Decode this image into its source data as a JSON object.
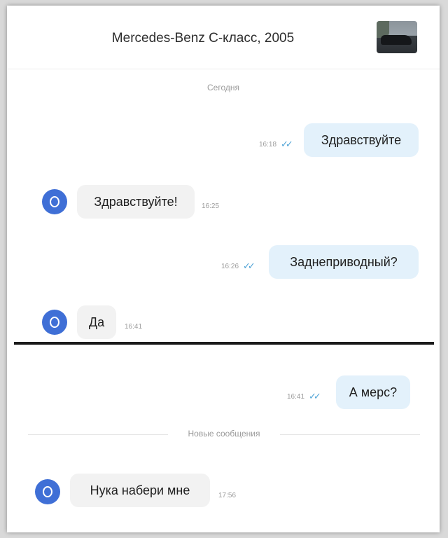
{
  "header": {
    "title": "Mercedes-Benz C-класс, 2005",
    "thumbnail_icon": "car-photo"
  },
  "day_label": "Сегодня",
  "messages": [
    {
      "direction": "out",
      "text": "Здравствуйте",
      "time": "16:18",
      "ticks": "✓✓"
    },
    {
      "direction": "in",
      "text": "Здравствуйте!",
      "time": "16:25",
      "avatar": "О"
    },
    {
      "direction": "out",
      "text": "Заднеприводный?",
      "time": "16:26",
      "ticks": "✓✓"
    },
    {
      "direction": "in",
      "text": "Да",
      "time": "16:41",
      "avatar": "О"
    },
    {
      "direction": "out",
      "text": "А мерс?",
      "time": "16:41",
      "ticks": "✓✓"
    },
    {
      "direction": "in",
      "text": "Нука набери мне",
      "time": "17:56",
      "avatar": "О"
    }
  ],
  "new_messages_label": "Новые сообщения",
  "colors": {
    "outgoing_bubble": "#e3f1fb",
    "incoming_bubble": "#f2f2f2",
    "avatar": "#3f6fd6",
    "read_ticks": "#4fa3d6"
  }
}
